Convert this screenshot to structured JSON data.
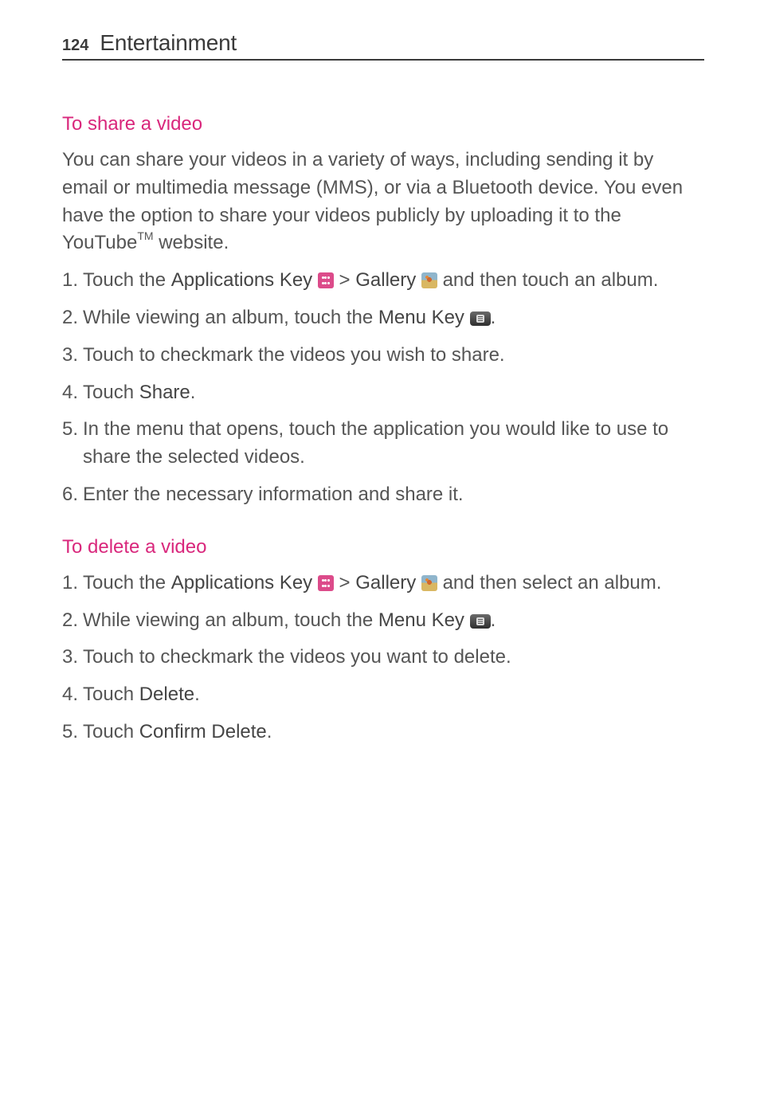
{
  "header": {
    "page_number": "124",
    "title": "Entertainment"
  },
  "sections": {
    "share": {
      "title": "To share a video",
      "intro_segments": [
        "You can share your videos in a variety of ways, including sending it by email or multimedia message (MMS), or via a Bluetooth device. You even have the option to share your videos publicly by uploading it to the YouTube",
        "TM",
        " website."
      ],
      "steps": {
        "s1": {
          "pre": "Touch the ",
          "apps": "Applications Key ",
          "sep": " > ",
          "gallery": "Gallery ",
          "post": " and then touch an album."
        },
        "s2": {
          "pre": "While viewing an album, touch the ",
          "menu": "Menu Key ",
          "post": "."
        },
        "s3": "Touch to checkmark the videos you wish to share.",
        "s4": {
          "pre": "Touch ",
          "bold": "Share",
          "post": "."
        },
        "s5": "In the menu that opens, touch the application you would like to use to share the selected videos.",
        "s6": "Enter the necessary information and share it."
      }
    },
    "del": {
      "title": "To delete a video",
      "steps": {
        "s1": {
          "pre": "Touch the ",
          "apps": "Applications Key ",
          "sep": " > ",
          "gallery": "Gallery ",
          "post": " and then select an album."
        },
        "s2": {
          "pre": "While viewing an album, touch the ",
          "menu": "Menu Key ",
          "post": "."
        },
        "s3": "Touch to checkmark the videos you want to delete.",
        "s4": {
          "pre": "Touch ",
          "bold": "Delete",
          "post": "."
        },
        "s5": {
          "pre": "Touch ",
          "bold": "Confirm Delete",
          "post": "."
        }
      }
    }
  }
}
